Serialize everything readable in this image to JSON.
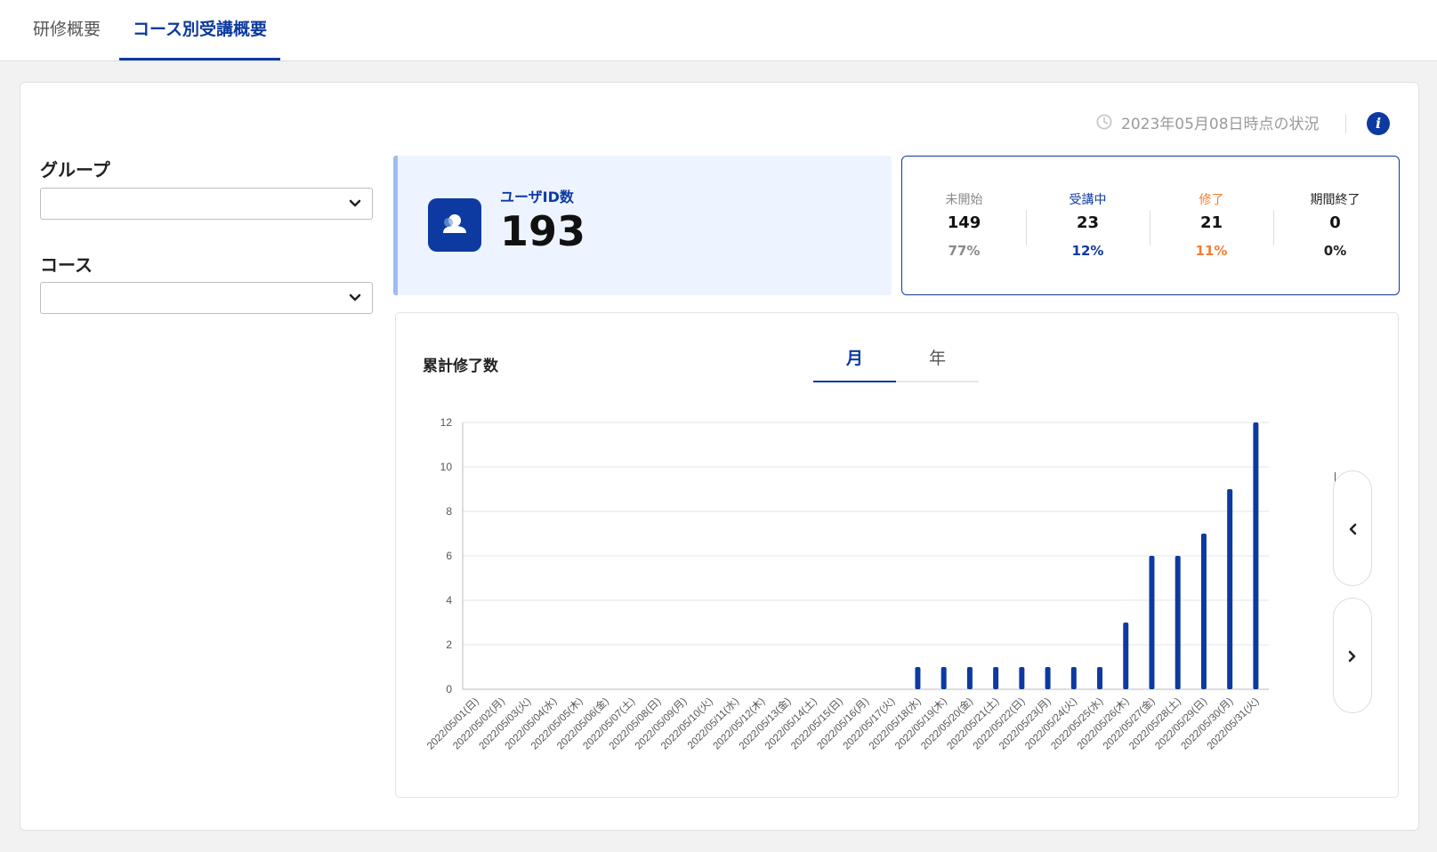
{
  "tabs": [
    {
      "label": "研修概要",
      "active": false
    },
    {
      "label": "コース別受講概要",
      "active": true
    }
  ],
  "status_text": "2023年05月08日時点の状況",
  "filters": {
    "group_label": "グループ",
    "group_value": "",
    "course_label": "コース",
    "course_value": ""
  },
  "users": {
    "label": "ユーザID数",
    "count": "193"
  },
  "stats": [
    {
      "label": "未開始",
      "value": "149",
      "percent": "77%",
      "color": "#8a8a8a",
      "pcolor": "#8a8a8a"
    },
    {
      "label": "受講中",
      "value": "23",
      "percent": "12%",
      "color": "#0d3aa0",
      "pcolor": "#0d3aa0"
    },
    {
      "label": "修了",
      "value": "21",
      "percent": "11%",
      "color": "#f07f33",
      "pcolor": "#f07f33"
    },
    {
      "label": "期間終了",
      "value": "0",
      "percent": "0%",
      "color": "#222222",
      "pcolor": "#222222"
    }
  ],
  "chart_title": "累計修了数",
  "period_tabs": [
    {
      "label": "月",
      "active": true
    },
    {
      "label": "年",
      "active": false
    }
  ],
  "colors": {
    "accent": "#0d3aa0",
    "orange": "#f07f33",
    "bar": "#0d3aa0"
  },
  "icons": {
    "clock": "clock-icon",
    "info": "info-icon",
    "user": "user-icon",
    "prev": "chevron-left-icon",
    "next": "chevron-right-icon",
    "select": "chevron-down-icon"
  },
  "chart_data": {
    "type": "bar",
    "title": "",
    "xlabel": "",
    "ylabel": "",
    "ylim": [
      0,
      12
    ],
    "yticks": [
      0,
      2,
      4,
      6,
      8,
      10,
      12
    ],
    "grid": true,
    "categories": [
      "2022/05/01(日)",
      "2022/05/02(月)",
      "2022/05/03(火)",
      "2022/05/04(水)",
      "2022/05/05(木)",
      "2022/05/06(金)",
      "2022/05/07(土)",
      "2022/05/08(日)",
      "2022/05/09(月)",
      "2022/05/10(火)",
      "2022/05/11(水)",
      "2022/05/12(木)",
      "2022/05/13(金)",
      "2022/05/14(土)",
      "2022/05/15(日)",
      "2022/05/16(月)",
      "2022/05/17(火)",
      "2022/05/18(水)",
      "2022/05/19(木)",
      "2022/05/20(金)",
      "2022/05/21(土)",
      "2022/05/22(日)",
      "2022/05/23(月)",
      "2022/05/24(火)",
      "2022/05/25(水)",
      "2022/05/26(木)",
      "2022/05/27(金)",
      "2022/05/28(土)",
      "2022/05/29(日)",
      "2022/05/30(月)",
      "2022/05/31(火)"
    ],
    "values": [
      0,
      0,
      0,
      0,
      0,
      0,
      0,
      0,
      0,
      0,
      0,
      0,
      0,
      0,
      0,
      0,
      0,
      1,
      1,
      1,
      1,
      1,
      1,
      1,
      1,
      3,
      6,
      6,
      7,
      9,
      12
    ]
  }
}
